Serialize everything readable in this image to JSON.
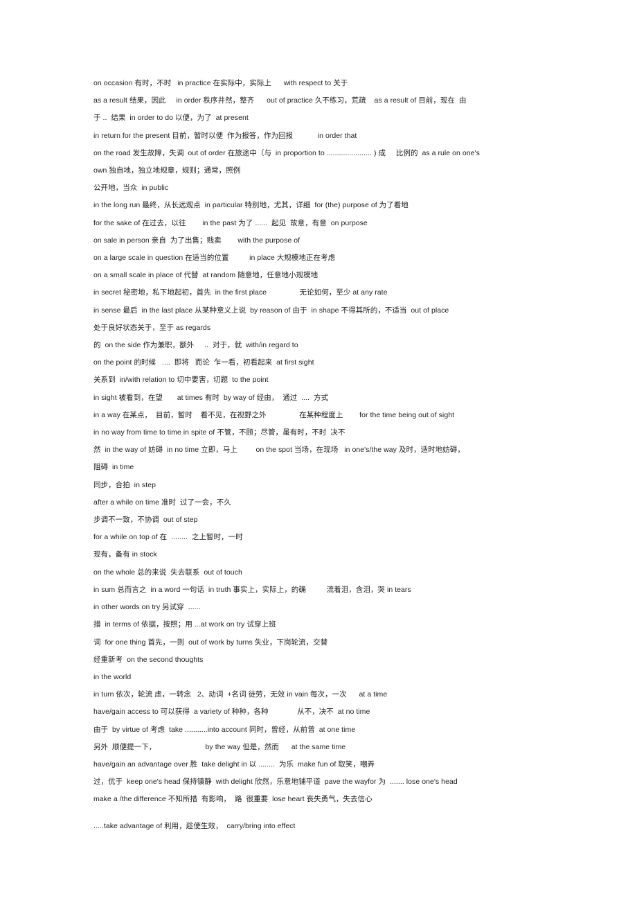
{
  "document": {
    "type": "phrase-list-notes",
    "background_color": "#ffffff",
    "text_color": "#1c1c1c",
    "lines": [
      "on occasion 有时，不时   in practice 在实际中，实际上      with respect to 关于",
      "as a result 结果，因此     in order 秩序井然，整齐      out of practice 久不练习，荒疏    as a result of 目前，现在  由",
      "于 ..  结果  in order to do 以便，为了  at present",
      "in return for the present 目前，暂时以便  作为报答，作为回报            in order that",
      "on the road 发生故障，失调  out of order 在旅途中（与  in proportion to ...................... ) 成     比例的  as a rule on one's",
      "own 独自地，独立地规章，规则；通常，照例",
      "公开地，当众  in public",
      "in the long run 最终，从长远观点  in particular 特别地，尤其，详细  for (the) purpose of 为了看地",
      "for the sake of 在过去，以往        in the past 为了 ......  起见  故意，有意  on purpose",
      "on sale in person 亲自  为了出售；贱卖        with the purpose of",
      "on a large scale in question 在适当的位置          in place 大规模地正在考虑",
      "on a small scale in place of 代替  at random 随意地，任意地小规模地",
      "in secret 秘密地，私下地起初，首先  in the first place                无论如何，至少 at any rate",
      "in sense 最后  in the last place 从某种意义上说  by reason of 由于  in shape 不得其所的，不适当  out of place",
      "处于良好状态关于，至于 as regards",
      "的  on the side 作为兼职，额外     ..  对于，就  with/in regard to",
      "on the point 的时候   ....  即将   而论  乍一看，初看起来  at first sight",
      "关系到  in/with relation to 切中要害，切题  to the point",
      "in sight 被看到，在望       at times 有时  by way of 经由，  通过  ....  方式",
      "in a way 在某点，  目前，暂时    看不见，在视野之外                在某种程度上        for the time being out of sight",
      "in no way from time to time in spite of 不管，不顾；尽管，虽有时，不时  决不",
      "然  in the way of 妨碍  in no time 立即，马上         on the spot 当场，在现场   in one's/the way 及时，适时地妨碍，",
      "阻碍  in time",
      "同步，合拍  in step",
      "after a while on time 准时  过了一会，不久",
      "步调不一致，不协调  out of step",
      "for a while on top of 在  ........  之上暂时，一时",
      "现有，备有 in stock",
      "on the whole 总的来说  失去联系  out of touch",
      "in sum 总而言之  in a word 一句话  in truth 事实上，实际上，的确          流着泪，含泪，哭 in tears",
      "in other words on try 另试穿  ......",
      "措  in terms of 依据，按照；用 ...at work on try 试穿上班",
      "词  for one thing 首先，一则  out of work by turns 失业，下岗轮流，交替",
      "经重新考  on the second thoughts",
      "in the world",
      "in turn 依次，轮流 虑，一转念   2、动词  +名词 徒劳，无效 in vain 每次，一次      at a time",
      "have/gain access to 可以获得  a variety of 种种，各种              从不，决不  at no time",
      "由于  by virtue of 考虑  take ...........into account 同时，曾经，从前曾  at one time",
      "另外  顺便提一下，                        by the way 但是，然而      at the same time",
      "have/gain an advantage over 胜  take delight in 以 ........  为乐  make fun of 取笑，嘲弄",
      "过，优于  keep one's head 保持镇静  with delight 欣然，乐意地铺平道  pave the wayfor 为  ....... lose one's head",
      "make a /the difference 不知所措  有影响，  路  很重要  lose heart 丧失勇气，失去信心",
      ".....take advantage of 利用，趁使生效，  carry/bring into effect"
    ],
    "gap_before_indices": [
      42
    ]
  }
}
